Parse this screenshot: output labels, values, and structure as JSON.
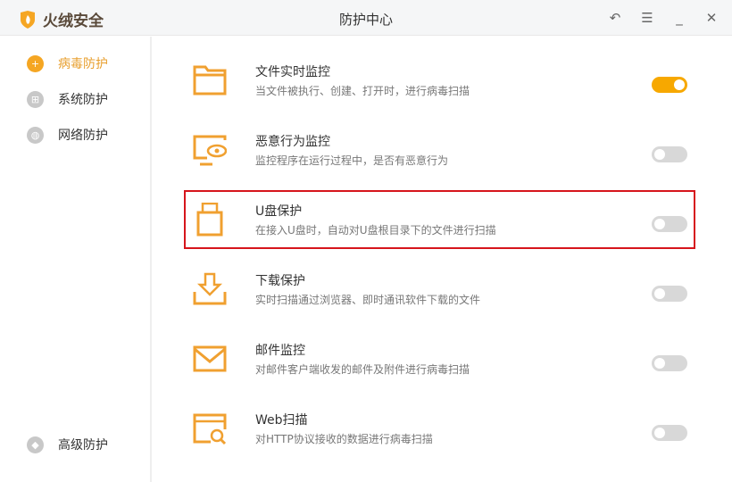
{
  "app": {
    "name": "火绒安全",
    "title": "防护中心"
  },
  "window_buttons": [
    "back",
    "menu",
    "minimize",
    "close"
  ],
  "sidebar": {
    "items": [
      {
        "label": "病毒防护",
        "active": true
      },
      {
        "label": "系统防护"
      },
      {
        "label": "网络防护"
      }
    ],
    "bottom": {
      "label": "高级防护"
    }
  },
  "items": [
    {
      "title": "文件实时监控",
      "desc": "当文件被执行、创建、打开时，进行病毒扫描",
      "enabled": true,
      "icon": "folder-icon"
    },
    {
      "title": "恶意行为监控",
      "desc": "监控程序在运行过程中，是否有恶意行为",
      "enabled": false,
      "icon": "monitor-eye-icon"
    },
    {
      "title": "U盘保护",
      "desc": "在接入U盘时，自动对U盘根目录下的文件进行扫描",
      "enabled": false,
      "icon": "usb-icon",
      "highlighted": true
    },
    {
      "title": "下载保护",
      "desc": "实时扫描通过浏览器、即时通讯软件下载的文件",
      "enabled": false,
      "icon": "download-icon"
    },
    {
      "title": "邮件监控",
      "desc": "对邮件客户端收发的邮件及附件进行病毒扫描",
      "enabled": false,
      "icon": "mail-icon"
    },
    {
      "title": "Web扫描",
      "desc": "对HTTP协议接收的数据进行病毒扫描",
      "enabled": false,
      "icon": "web-scan-icon"
    }
  ],
  "colors": {
    "accent": "#f5a623",
    "highlight": "#d6151c"
  }
}
